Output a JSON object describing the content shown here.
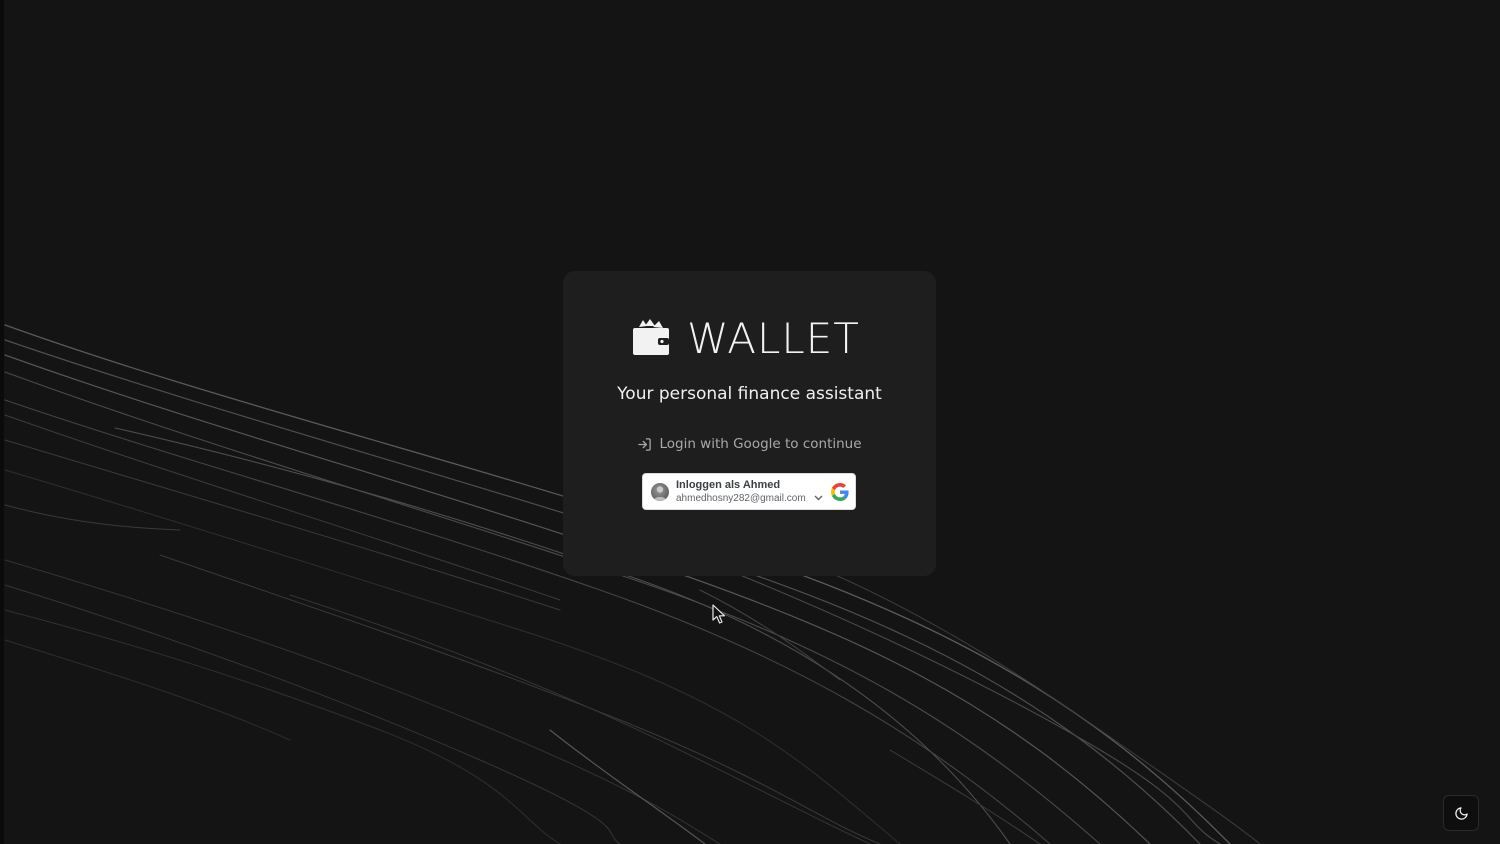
{
  "brand": {
    "name": "WALLET",
    "icon": "wallet-icon"
  },
  "tagline": "Your personal finance assistant",
  "login_hint": {
    "text": "Login with Google to continue",
    "icon": "log-in-icon"
  },
  "google_button": {
    "title": "Inloggen als Ahmed",
    "email": "ahmedhosny282@gmail.com",
    "icon": "google-icon",
    "dropdown_icon": "chevron-down-icon"
  },
  "theme_toggle": {
    "icon": "moon-icon"
  },
  "colors": {
    "background": "#141414",
    "card": "#1e1e1f",
    "text_primary": "#f0f0f0",
    "text_muted": "#a9a9a9"
  }
}
